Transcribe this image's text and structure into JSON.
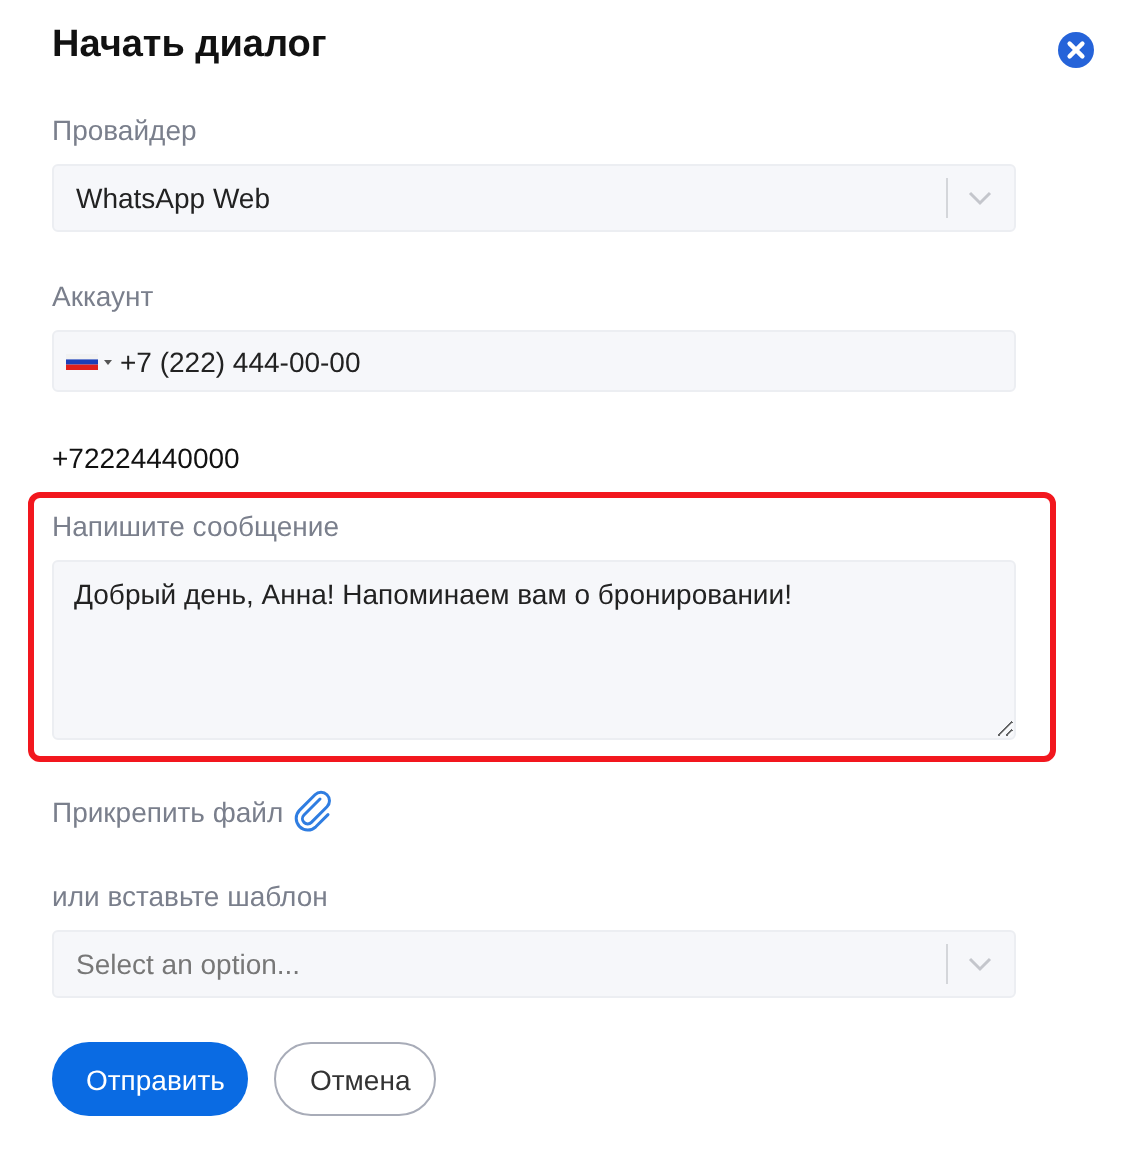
{
  "dialog": {
    "title": "Начать диалог"
  },
  "provider": {
    "label": "Провайдер",
    "value": "WhatsApp Web"
  },
  "account": {
    "label": "Аккаунт",
    "value": "+7 (222) 444-00-00"
  },
  "number": "+72224440000",
  "message": {
    "label": "Напишите сообщение",
    "value": "Добрый день, Анна! Напоминаем вам о бронировании!",
    "highlighted": true
  },
  "attach": {
    "label": "Прикрепить файл"
  },
  "template": {
    "label": "или вставьте шаблон",
    "placeholder": "Select an option..."
  },
  "buttons": [
    {
      "label": "Отправить",
      "kind": "primary"
    },
    {
      "label": "Отмена",
      "kind": "secondary"
    }
  ]
}
